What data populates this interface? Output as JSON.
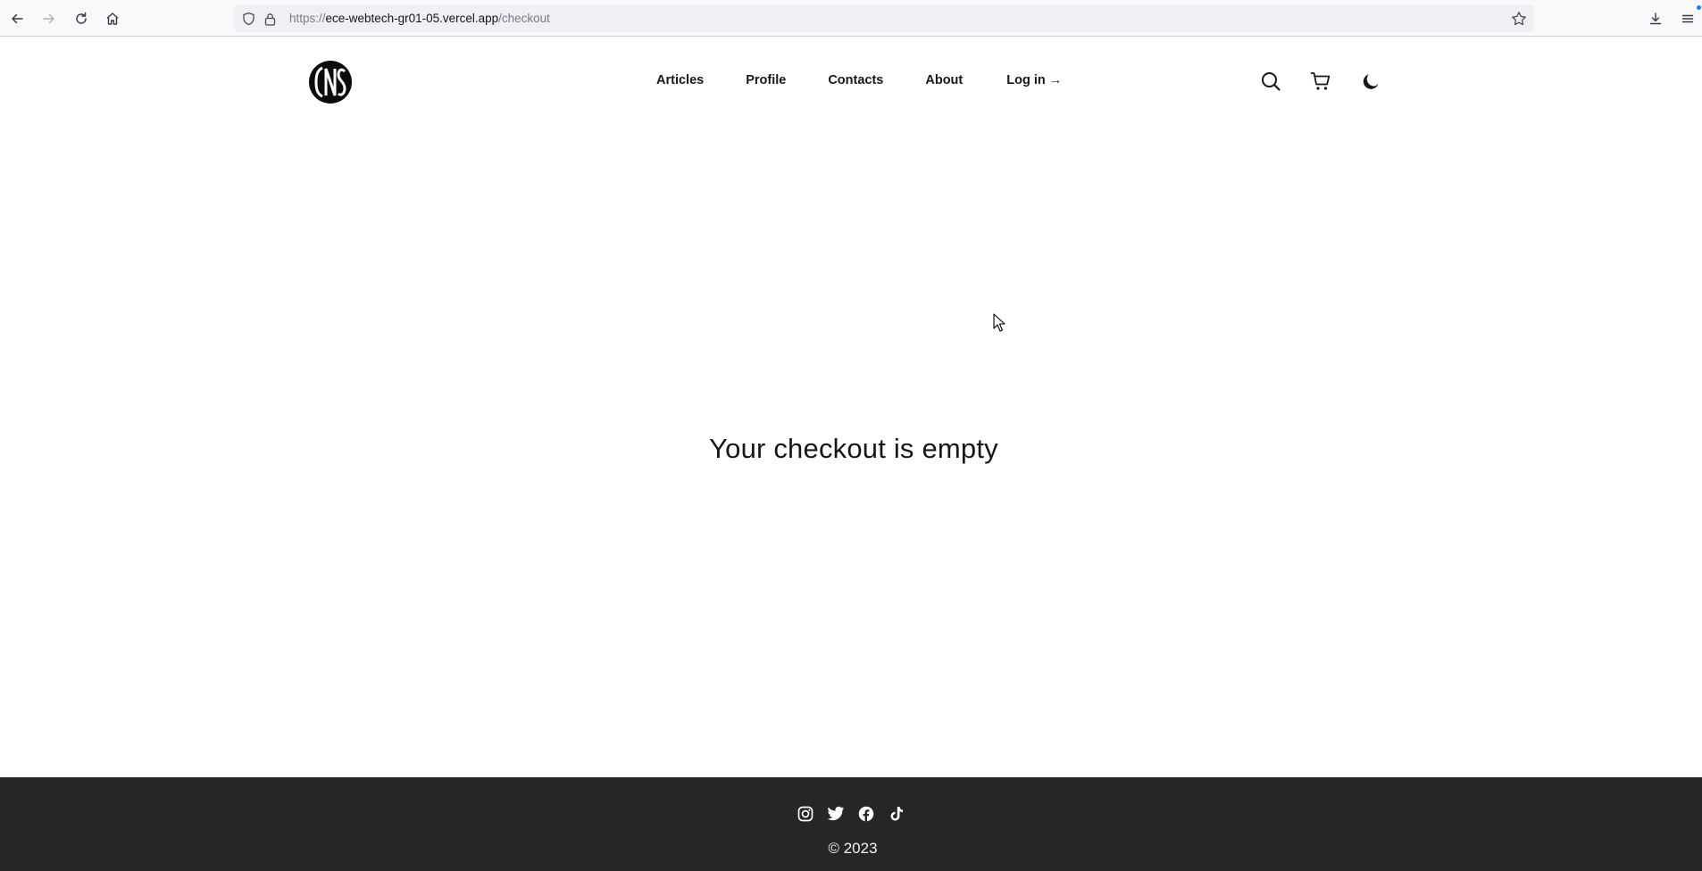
{
  "browser": {
    "url_scheme": "https://",
    "url_host": "ece-webtech-gr01-05.vercel.app",
    "url_path": "/checkout",
    "icons": [
      "back-icon",
      "forward-icon",
      "reload-icon",
      "home-icon",
      "shield-icon",
      "lock-icon",
      "bookmark-star-icon",
      "download-icon",
      "menu-icon"
    ],
    "download_dot_color": "#0a84ff"
  },
  "header": {
    "logo_alt": "CNS",
    "nav": {
      "articles": "Articles",
      "profile": "Profile",
      "contacts": "Contacts",
      "about": "About",
      "login": "Log in →"
    },
    "icons": [
      "search-icon",
      "cart-icon",
      "dark-mode-moon-icon"
    ]
  },
  "main": {
    "empty_message": "Your checkout is empty"
  },
  "footer": {
    "socials": [
      "instagram-icon",
      "twitter-icon",
      "facebook-icon",
      "tiktok-icon"
    ],
    "copyright": "© 2023",
    "background": "#262626"
  }
}
